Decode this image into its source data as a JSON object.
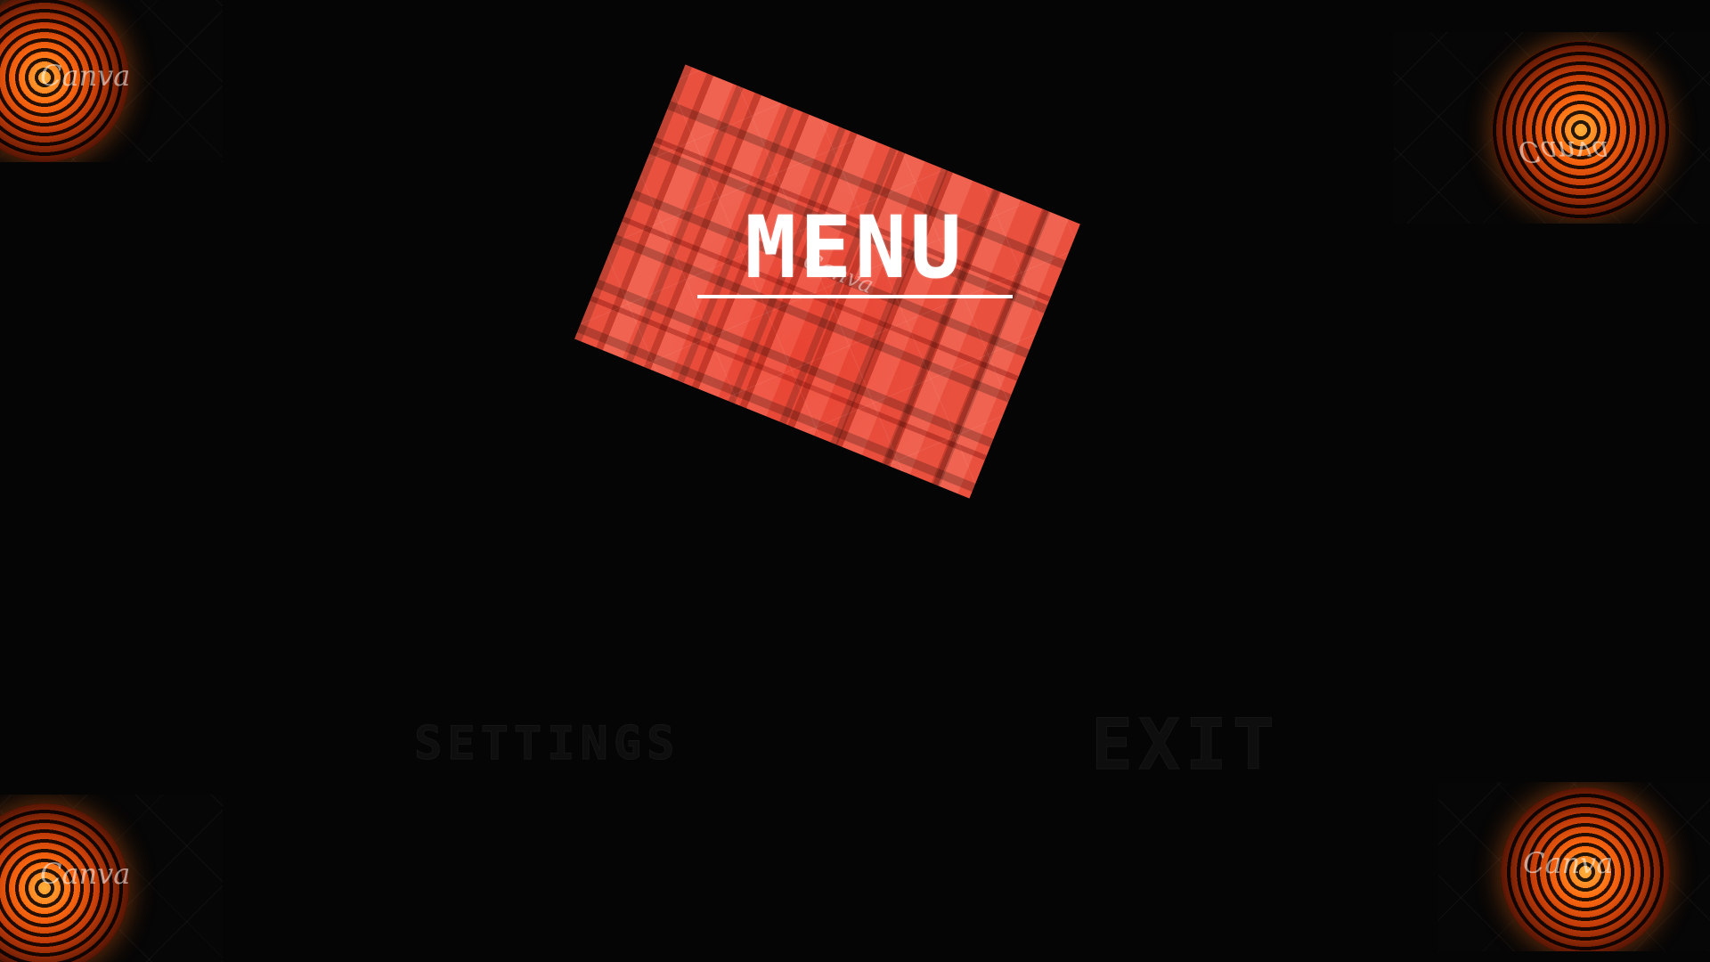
{
  "menu": {
    "title": "MENU",
    "options": [
      {
        "label": "SETTINGS"
      },
      {
        "label": "EXIT"
      }
    ]
  },
  "watermark": "Canva",
  "colors": {
    "background": "#050505",
    "card": "#e9503e",
    "title": "#ffffff",
    "option_text": "#0e0e0e",
    "corner_glow": "#ff6a10"
  },
  "icons": [
    "maze-disc-icon",
    "maze-disc-icon",
    "maze-disc-icon",
    "maze-disc-icon"
  ]
}
